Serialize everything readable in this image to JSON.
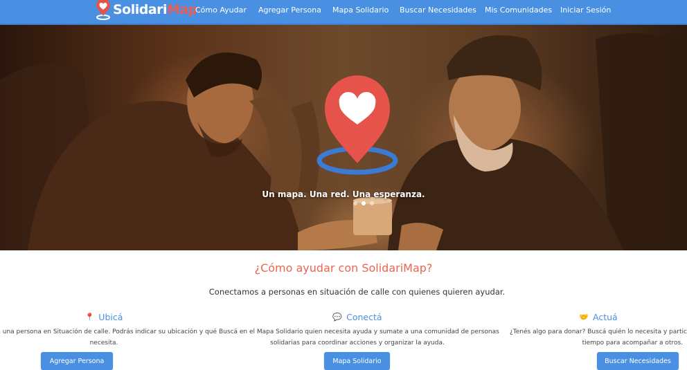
{
  "brand": {
    "name_a": "Solidari",
    "name_b": "Map"
  },
  "nav": {
    "items": [
      "Cómo Ayudar",
      "Agregar Persona",
      "Mapa Solidario",
      "Buscar Necesidades",
      "Mis Comunidades",
      "Iniciar Sesión"
    ]
  },
  "hero": {
    "caption": "Un mapa. Una red. Una esperanza.",
    "slide_count": 3,
    "active_slide": 2
  },
  "section": {
    "title": "¿Cómo ayudar con SolidariMap?",
    "subtitle": "Conectamos a personas en situación de calle con quienes quieren ayudar."
  },
  "columns": [
    {
      "icon": "pin-icon",
      "icon_glyph": "📍",
      "title": "Ubicá",
      "line1": "a a una persona en Situación de calle. Podrás indicar su ubicación y qué",
      "line2": "necesita.",
      "button": "Agregar Persona"
    },
    {
      "icon": "speech-bubble-icon",
      "icon_glyph": "💬",
      "title": "Conectá",
      "line1": "Buscá en el Mapa Solidario quien necesita ayuda y sumate a una comunidad de personas",
      "line2": "solidarias para coordinar acciones y organizar la ayuda.",
      "button": "Mapa Solidario"
    },
    {
      "icon": "handshake-icon",
      "icon_glyph": "🤝",
      "title": "Actuá",
      "line1": "¿Tenés algo para donar? Buscá quién lo necesita y participá li",
      "line2": "tiempo para acompañar a otros.",
      "button": "Buscar Necesidades"
    }
  ],
  "colors": {
    "primary": "#4a90e2",
    "accent": "#e8664f",
    "pin_red": "#e5534b",
    "pin_ring": "#3a7bd5"
  }
}
